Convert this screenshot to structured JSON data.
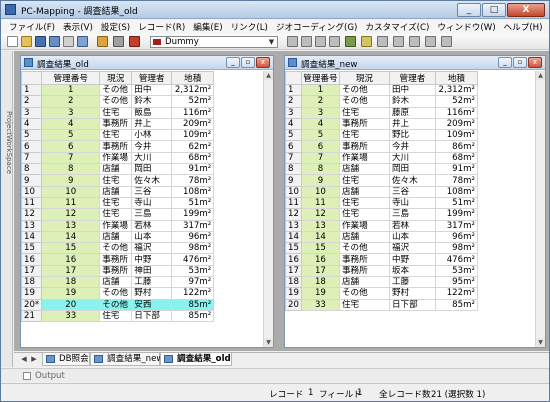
{
  "app": {
    "title": "PC-Mapping - 調査結果_old",
    "min": "_",
    "max": "□",
    "close": "X"
  },
  "menu": [
    "ファイル(F)",
    "表示(V)",
    "設定(S)",
    "レコード(R)",
    "編集(E)",
    "リンク(L)",
    "ジオコーディング(G)",
    "カスタマイズ(C)",
    "ウィンドウ(W)",
    "ヘルプ(H)"
  ],
  "toolbar": {
    "layer_select": "Dummy"
  },
  "side_panel": {
    "label": "ProjectWorkSpace"
  },
  "columns": [
    "管理番号",
    "現況",
    "管理者",
    "地積"
  ],
  "window_old": {
    "title": "調査結果_old",
    "rows": [
      {
        "rh": "1",
        "num": "1",
        "status": "その他",
        "mgr": "田中",
        "area": "2,312m²"
      },
      {
        "rh": "2",
        "num": "2",
        "status": "その他",
        "mgr": "鈴木",
        "area": "52m²"
      },
      {
        "rh": "3",
        "num": "3",
        "status": "住宅",
        "mgr": "飯島",
        "area": "116m²"
      },
      {
        "rh": "4",
        "num": "4",
        "status": "事務所",
        "mgr": "井上",
        "area": "209m²"
      },
      {
        "rh": "5",
        "num": "5",
        "status": "住宅",
        "mgr": "小林",
        "area": "109m²"
      },
      {
        "rh": "6",
        "num": "6",
        "status": "事務所",
        "mgr": "今井",
        "area": "62m²"
      },
      {
        "rh": "7",
        "num": "7",
        "status": "作業場",
        "mgr": "大川",
        "area": "68m²"
      },
      {
        "rh": "8",
        "num": "8",
        "status": "店舗",
        "mgr": "岡田",
        "area": "91m²"
      },
      {
        "rh": "9",
        "num": "9",
        "status": "住宅",
        "mgr": "佐々木",
        "area": "78m²"
      },
      {
        "rh": "10",
        "num": "10",
        "status": "店舗",
        "mgr": "三谷",
        "area": "108m²"
      },
      {
        "rh": "11",
        "num": "11",
        "status": "住宅",
        "mgr": "寺山",
        "area": "51m²"
      },
      {
        "rh": "12",
        "num": "12",
        "status": "住宅",
        "mgr": "三島",
        "area": "199m²"
      },
      {
        "rh": "13",
        "num": "13",
        "status": "作業場",
        "mgr": "若林",
        "area": "317m²"
      },
      {
        "rh": "14",
        "num": "14",
        "status": "店舗",
        "mgr": "山本",
        "area": "96m²"
      },
      {
        "rh": "15",
        "num": "15",
        "status": "その他",
        "mgr": "福沢",
        "area": "98m²"
      },
      {
        "rh": "16",
        "num": "16",
        "status": "事務所",
        "mgr": "中野",
        "area": "476m²"
      },
      {
        "rh": "17",
        "num": "17",
        "status": "事務所",
        "mgr": "神田",
        "area": "53m²"
      },
      {
        "rh": "18",
        "num": "18",
        "status": "店舗",
        "mgr": "工藤",
        "area": "97m²"
      },
      {
        "rh": "19",
        "num": "19",
        "status": "その他",
        "mgr": "野村",
        "area": "122m²"
      },
      {
        "rh": "20*",
        "num": "20",
        "status": "その他",
        "mgr": "安西",
        "area": "85m²",
        "selected": true
      },
      {
        "rh": "21",
        "num": "33",
        "status": "住宅",
        "mgr": "日下部",
        "area": "85m²"
      }
    ]
  },
  "window_new": {
    "title": "調査結果_new",
    "rows": [
      {
        "rh": "1",
        "num": "1",
        "status": "その他",
        "mgr": "田中",
        "area": "2,312m²"
      },
      {
        "rh": "2",
        "num": "2",
        "status": "その他",
        "mgr": "鈴木",
        "area": "52m²"
      },
      {
        "rh": "3",
        "num": "3",
        "status": "住宅",
        "mgr": "藤原",
        "area": "116m²"
      },
      {
        "rh": "4",
        "num": "4",
        "status": "事務所",
        "mgr": "井上",
        "area": "209m²"
      },
      {
        "rh": "5",
        "num": "5",
        "status": "住宅",
        "mgr": "野比",
        "area": "109m²"
      },
      {
        "rh": "6",
        "num": "6",
        "status": "事務所",
        "mgr": "今井",
        "area": "86m²"
      },
      {
        "rh": "7",
        "num": "7",
        "status": "作業場",
        "mgr": "大川",
        "area": "68m²"
      },
      {
        "rh": "8",
        "num": "8",
        "status": "店舗",
        "mgr": "岡田",
        "area": "91m²"
      },
      {
        "rh": "9",
        "num": "9",
        "status": "住宅",
        "mgr": "佐々木",
        "area": "78m²"
      },
      {
        "rh": "10",
        "num": "10",
        "status": "店舗",
        "mgr": "三谷",
        "area": "108m²"
      },
      {
        "rh": "11",
        "num": "11",
        "status": "住宅",
        "mgr": "寺山",
        "area": "51m²"
      },
      {
        "rh": "12",
        "num": "12",
        "status": "住宅",
        "mgr": "三島",
        "area": "199m²"
      },
      {
        "rh": "13",
        "num": "13",
        "status": "作業場",
        "mgr": "若林",
        "area": "317m²"
      },
      {
        "rh": "14",
        "num": "14",
        "status": "店舗",
        "mgr": "山本",
        "area": "96m²"
      },
      {
        "rh": "15",
        "num": "15",
        "status": "その他",
        "mgr": "福沢",
        "area": "98m²"
      },
      {
        "rh": "16",
        "num": "16",
        "status": "事務所",
        "mgr": "中野",
        "area": "476m²"
      },
      {
        "rh": "17",
        "num": "17",
        "status": "事務所",
        "mgr": "坂本",
        "area": "53m²"
      },
      {
        "rh": "18",
        "num": "18",
        "status": "店舗",
        "mgr": "工藤",
        "area": "95m²"
      },
      {
        "rh": "19",
        "num": "19",
        "status": "その他",
        "mgr": "野村",
        "area": "122m²"
      },
      {
        "rh": "20",
        "num": "33",
        "status": "住宅",
        "mgr": "日下部",
        "area": "85m²"
      }
    ]
  },
  "tabs": [
    {
      "label": "DB照会"
    },
    {
      "label": "調査結果_new"
    },
    {
      "label": "調査結果_old",
      "active": true
    }
  ],
  "output": {
    "label": "Output"
  },
  "status": {
    "record_label": "レコード",
    "record_value": "1",
    "field_label": "フィールド",
    "field_value": "1",
    "total_label": "全レコード数",
    "total_value": "21 (選択数 1)"
  },
  "colors": {
    "num_cell": "#dcf0b8",
    "selected_row": "#89f2ee"
  }
}
